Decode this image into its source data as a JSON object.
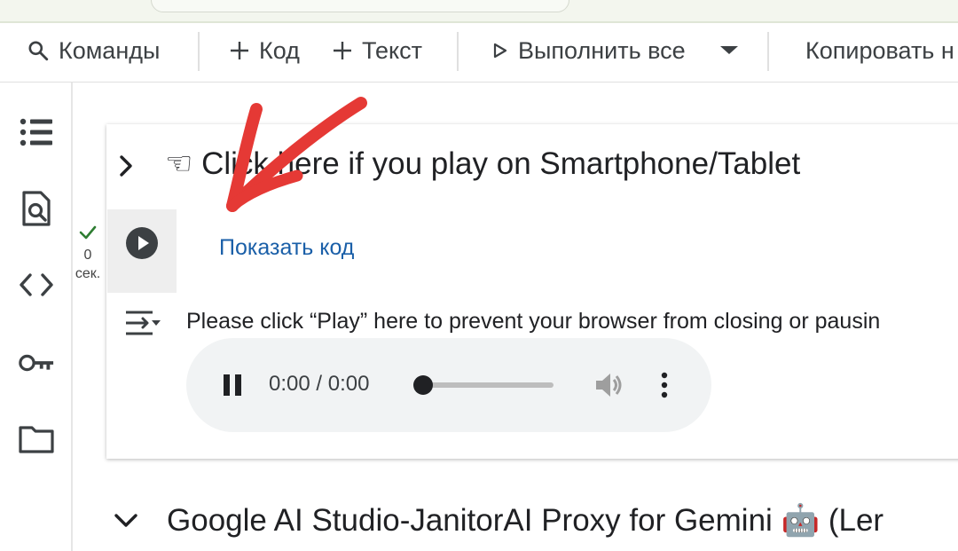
{
  "toolbar": {
    "commands_label": "Команды",
    "code_label": "Код",
    "text_label": "Текст",
    "run_all_label": "Выполнить все",
    "copy_label": "Копировать н"
  },
  "sidebar": {
    "icons": [
      "table-of-contents-icon",
      "find-in-files-icon",
      "code-snippets-icon",
      "secrets-key-icon",
      "files-folder-icon"
    ]
  },
  "cell": {
    "title": "☜ Click here if you play on Smartphone/Tablet",
    "run_status_line1": "0",
    "run_status_line2": "сек.",
    "show_code_label": "Показать код",
    "output_text": "Please click “Play” here to prevent your browser from closing or pausin"
  },
  "audio": {
    "time": "0:00 / 0:00",
    "progress": 0
  },
  "section": {
    "title": "Google AI Studio-JanitorAI Proxy for Gemini 🤖 (Ler"
  },
  "colors": {
    "link": "#1a5fa8",
    "annotation_arrow": "#e53935",
    "success_check": "#2e7d32"
  }
}
